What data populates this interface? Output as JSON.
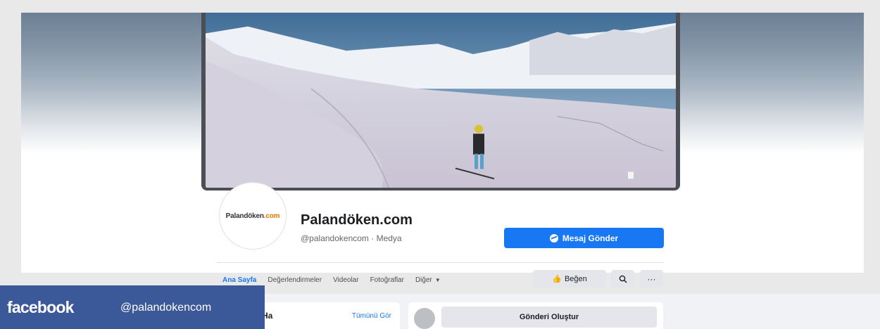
{
  "page": {
    "name": "Palandöken.com",
    "handle": "@palandokencom · Medya",
    "avatar_logo_main": "Palandöken",
    "avatar_logo_suffix": ".com"
  },
  "actions": {
    "message_label": "Mesaj Gönder",
    "like_label": "Beğen",
    "search_icon": "search-icon",
    "more_label": "···"
  },
  "tabs": [
    {
      "label": "Ana Sayfa",
      "active": true
    },
    {
      "label": "Değerlendirmeler",
      "active": false
    },
    {
      "label": "Videolar",
      "active": false
    },
    {
      "label": "Fotoğraflar",
      "active": false
    },
    {
      "label": "Diğer",
      "active": false
    }
  ],
  "left_card": {
    "title": "Ha",
    "see_all": "Tümünü Gör"
  },
  "composer": {
    "create_post_label": "Gönderi Oluştur"
  },
  "overlay": {
    "brand": "facebook",
    "handle": "@palandokencom"
  },
  "colors": {
    "accent": "#1877f2",
    "overlay_bar": "#3b5998"
  }
}
